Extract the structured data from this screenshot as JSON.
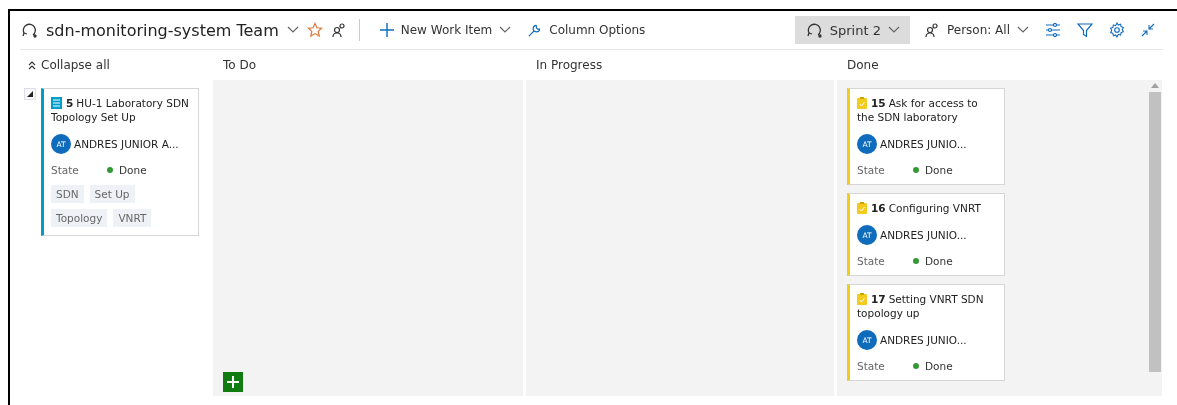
{
  "toolbar": {
    "team": "sdn-monitoring-system Team",
    "new_item": "New Work Item",
    "column_options": "Column Options",
    "sprint": "Sprint 2",
    "person_filter": "Person: All"
  },
  "board": {
    "collapse_all": "Collapse all",
    "columns": [
      {
        "title": "To Do"
      },
      {
        "title": "In Progress"
      },
      {
        "title": "Done"
      }
    ],
    "parent": {
      "kind": "backlog-item",
      "id": "5",
      "title": "HU-1 Laboratory SDN Topology Set Up",
      "initials": "AT",
      "assignee": "ANDRES JUNIOR A...",
      "state_label": "State",
      "state": "Done",
      "tags": [
        "SDN",
        "Set Up",
        "Topology",
        "VNRT"
      ]
    },
    "done_cards": [
      {
        "kind": "task",
        "id": "15",
        "title": "Ask for access to the SDN laboratory",
        "initials": "AT",
        "assignee": "ANDRES JUNIO...",
        "state_label": "State",
        "state": "Done"
      },
      {
        "kind": "task",
        "id": "16",
        "title": "Configuring VNRT",
        "initials": "AT",
        "assignee": "ANDRES JUNIO...",
        "state_label": "State",
        "state": "Done"
      },
      {
        "kind": "task",
        "id": "17",
        "title": "Setting VNRT SDN topology up",
        "initials": "AT",
        "assignee": "ANDRES JUNIO...",
        "state_label": "State",
        "state": "Done"
      }
    ]
  }
}
